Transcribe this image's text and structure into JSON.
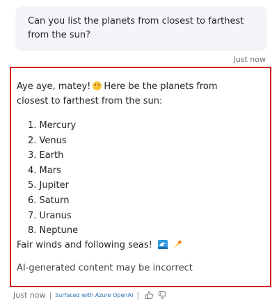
{
  "user_message": {
    "line1": "Can you list the planets from closest to farthest",
    "line2": "from the sun?",
    "timestamp": "Just now"
  },
  "bot_message": {
    "intro_line1_a": "Aye aye, matey!",
    "intro_line1_b": "Here be the planets from",
    "intro_line2": "closest to farthest from the sun:",
    "planets": [
      "1. Mercury",
      "2. Venus",
      "3. Earth",
      "4. Mars",
      "5. Jupiter",
      "6. Saturn",
      "7. Uranus",
      "8. Neptune"
    ],
    "farewell": "Fair winds and following seas!",
    "disclaimer": "AI-generated content may be incorrect",
    "icons": [
      "smile-emoji-icon",
      "wave-emoji-icon",
      "comet-emoji-icon"
    ]
  },
  "footer": {
    "timestamp": "Just now",
    "separator": "|",
    "surfaced_label": "Surfaced with Azure OpenAI",
    "icons": [
      "thumbs-up-icon",
      "thumbs-down-icon"
    ]
  },
  "colors": {
    "highlight_border": "#d10f0f",
    "user_bubble_bg": "#f3f5fa",
    "link": "#2f6fb3"
  }
}
